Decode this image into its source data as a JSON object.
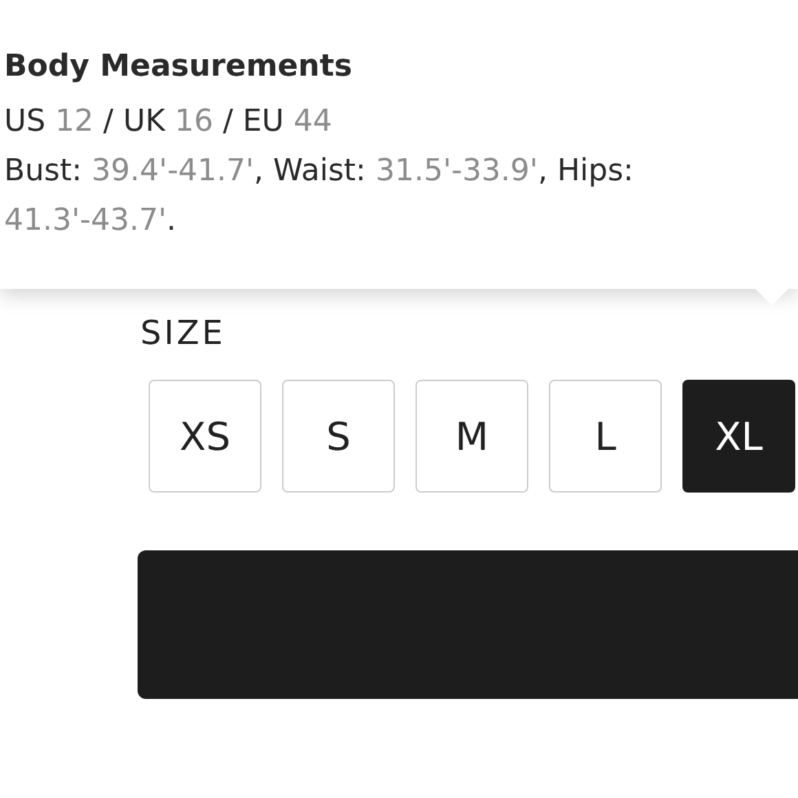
{
  "tooltip": {
    "title": "Body Measurements",
    "lines": [
      [
        {
          "text": "US ",
          "kind": "label"
        },
        {
          "text": "12",
          "kind": "value"
        },
        {
          "text": " / UK ",
          "kind": "label"
        },
        {
          "text": "16",
          "kind": "value"
        },
        {
          "text": " / EU ",
          "kind": "label"
        },
        {
          "text": "44",
          "kind": "value"
        }
      ],
      [
        {
          "text": "Bust: ",
          "kind": "label"
        },
        {
          "text": "39.4'-41.7'",
          "kind": "value"
        },
        {
          "text": ", Waist: ",
          "kind": "label"
        },
        {
          "text": "31.5'-33.9'",
          "kind": "value"
        },
        {
          "text": ", Hips: ",
          "kind": "label"
        },
        {
          "text": "41.3'-43.7'",
          "kind": "value"
        },
        {
          "text": ".",
          "kind": "label"
        }
      ]
    ]
  },
  "size_label": "SIZE",
  "sizes": [
    {
      "label": "XS",
      "selected": false
    },
    {
      "label": "S",
      "selected": false
    },
    {
      "label": "M",
      "selected": false
    },
    {
      "label": "L",
      "selected": false
    },
    {
      "label": "XL",
      "selected": true
    }
  ]
}
